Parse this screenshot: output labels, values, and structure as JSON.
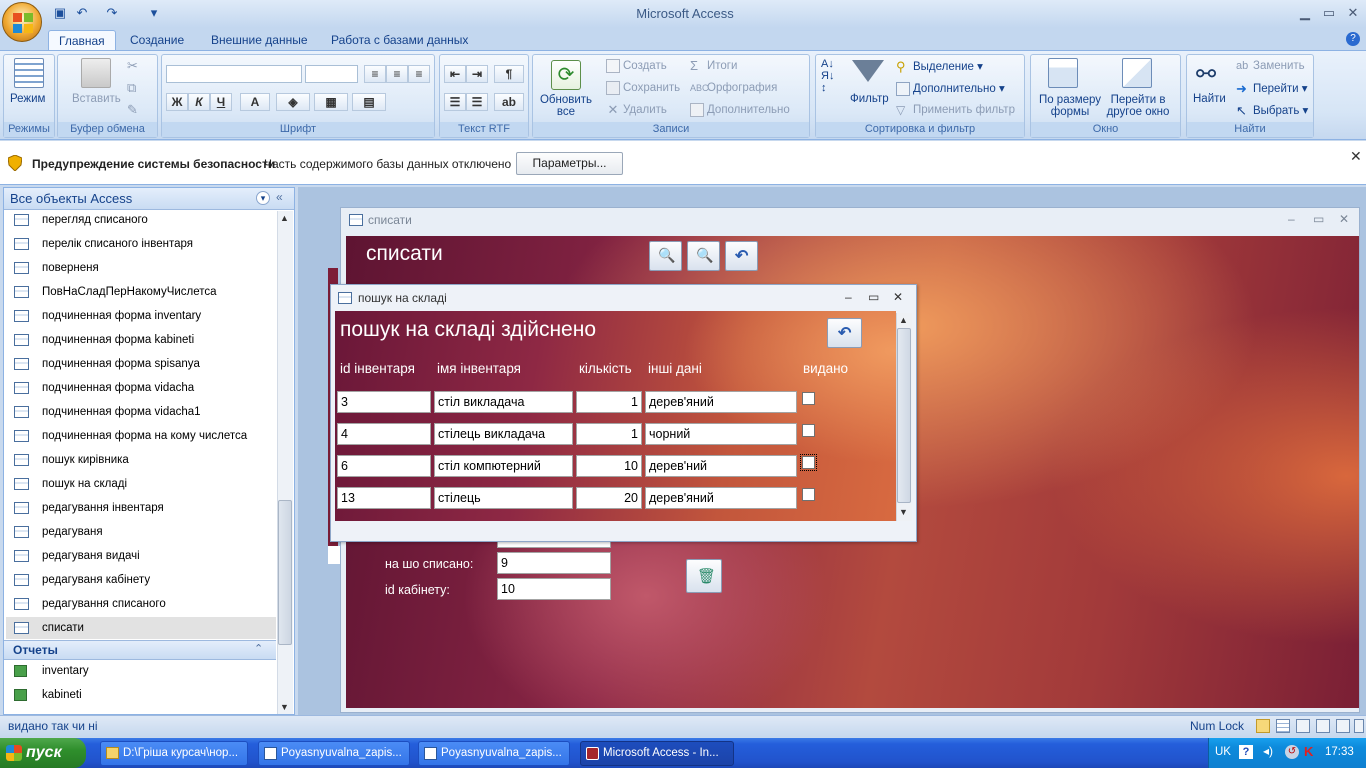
{
  "app": {
    "title": "Microsoft Access"
  },
  "tabs": [
    "Главная",
    "Создание",
    "Внешние данные",
    "Работа с базами данных"
  ],
  "ribbon": {
    "modes": {
      "button": "Режим",
      "label": "Режимы"
    },
    "clipboard": {
      "paste": "Вставить",
      "label": "Буфер обмена"
    },
    "font": {
      "label": "Шрифт",
      "bold": "Ж",
      "italic": "К",
      "underline": "Ч",
      "font_color": "A"
    },
    "rtf": {
      "label": "Текст RTF"
    },
    "records": {
      "refresh": "Обновить все",
      "create": "Создать",
      "save": "Сохранить",
      "delete": "Удалить",
      "totals": "Итоги",
      "spelling": "Орфография",
      "more": "Дополнительно",
      "label": "Записи"
    },
    "sort_filter": {
      "filter": "Фильтр",
      "selection": "Выделение",
      "advanced": "Дополнительно",
      "apply": "Применить фильтр",
      "label": "Сортировка и фильтр"
    },
    "window": {
      "fit_form": "По размеру формы",
      "switch": "Перейти в другое окно",
      "label": "Окно"
    },
    "find": {
      "find": "Найти",
      "replace": "Заменить",
      "goto": "Перейти",
      "select": "Выбрать",
      "label": "Найти"
    }
  },
  "security": {
    "title": "Предупреждение системы безопасности",
    "text": "Часть содержимого базы данных отключено",
    "button": "Параметры..."
  },
  "nav": {
    "title": "Все объекты Access",
    "items": [
      "перегляд списаного",
      "перелік списаного інвентаря",
      "поверненя",
      "ПовНаСладПерНакомуЧислетса",
      "подчиненная форма inventary",
      "подчиненная форма kabineti",
      "подчиненная форма spisanya",
      "подчиненная форма vidacha",
      "подчиненная форма vidacha1",
      "подчиненная форма на кому числетса",
      "пошук кирівника",
      "пошук на складі",
      "редагування інвентаря",
      "редагуваня",
      "редагуваня видачі",
      "редагуваня кабінету",
      "редагування списаного",
      "списати"
    ],
    "reports_title": "Отчеты",
    "reports": [
      "inventary",
      "kabineti"
    ]
  },
  "form_spysaty": {
    "window_title": "списати",
    "heading": "списати",
    "fields": [
      {
        "label": "на шо списано:",
        "value": "9"
      },
      {
        "label": "id кабінету:",
        "value": "10"
      }
    ]
  },
  "form_poshuk": {
    "window_title": "пошук на складі",
    "heading": "пошук на складі здійснено",
    "columns": [
      "id інвентаря",
      "імя інвентаря",
      "кількість",
      "інші дані",
      "видано"
    ],
    "rows": [
      [
        "3",
        "стіл викладача",
        "1",
        "дерев'яний"
      ],
      [
        "4",
        "стілець викладача",
        "1",
        "чорний"
      ],
      [
        "6",
        "стіл компютерний",
        "10",
        "дерев'ний"
      ],
      [
        "13",
        "стілець",
        "20",
        "дерев'яний"
      ]
    ]
  },
  "status": {
    "text": "видано так чи ні",
    "numlock": "Num Lock"
  },
  "taskbar": {
    "start": "пуск",
    "tasks": [
      "D:\\Гріша курсач\\нор...",
      "Poyasnyuvalna_zapis...",
      "Poyasnyuvalna_zapis...",
      "Microsoft Access - In..."
    ],
    "lang": "UK",
    "clock": "17:33"
  }
}
